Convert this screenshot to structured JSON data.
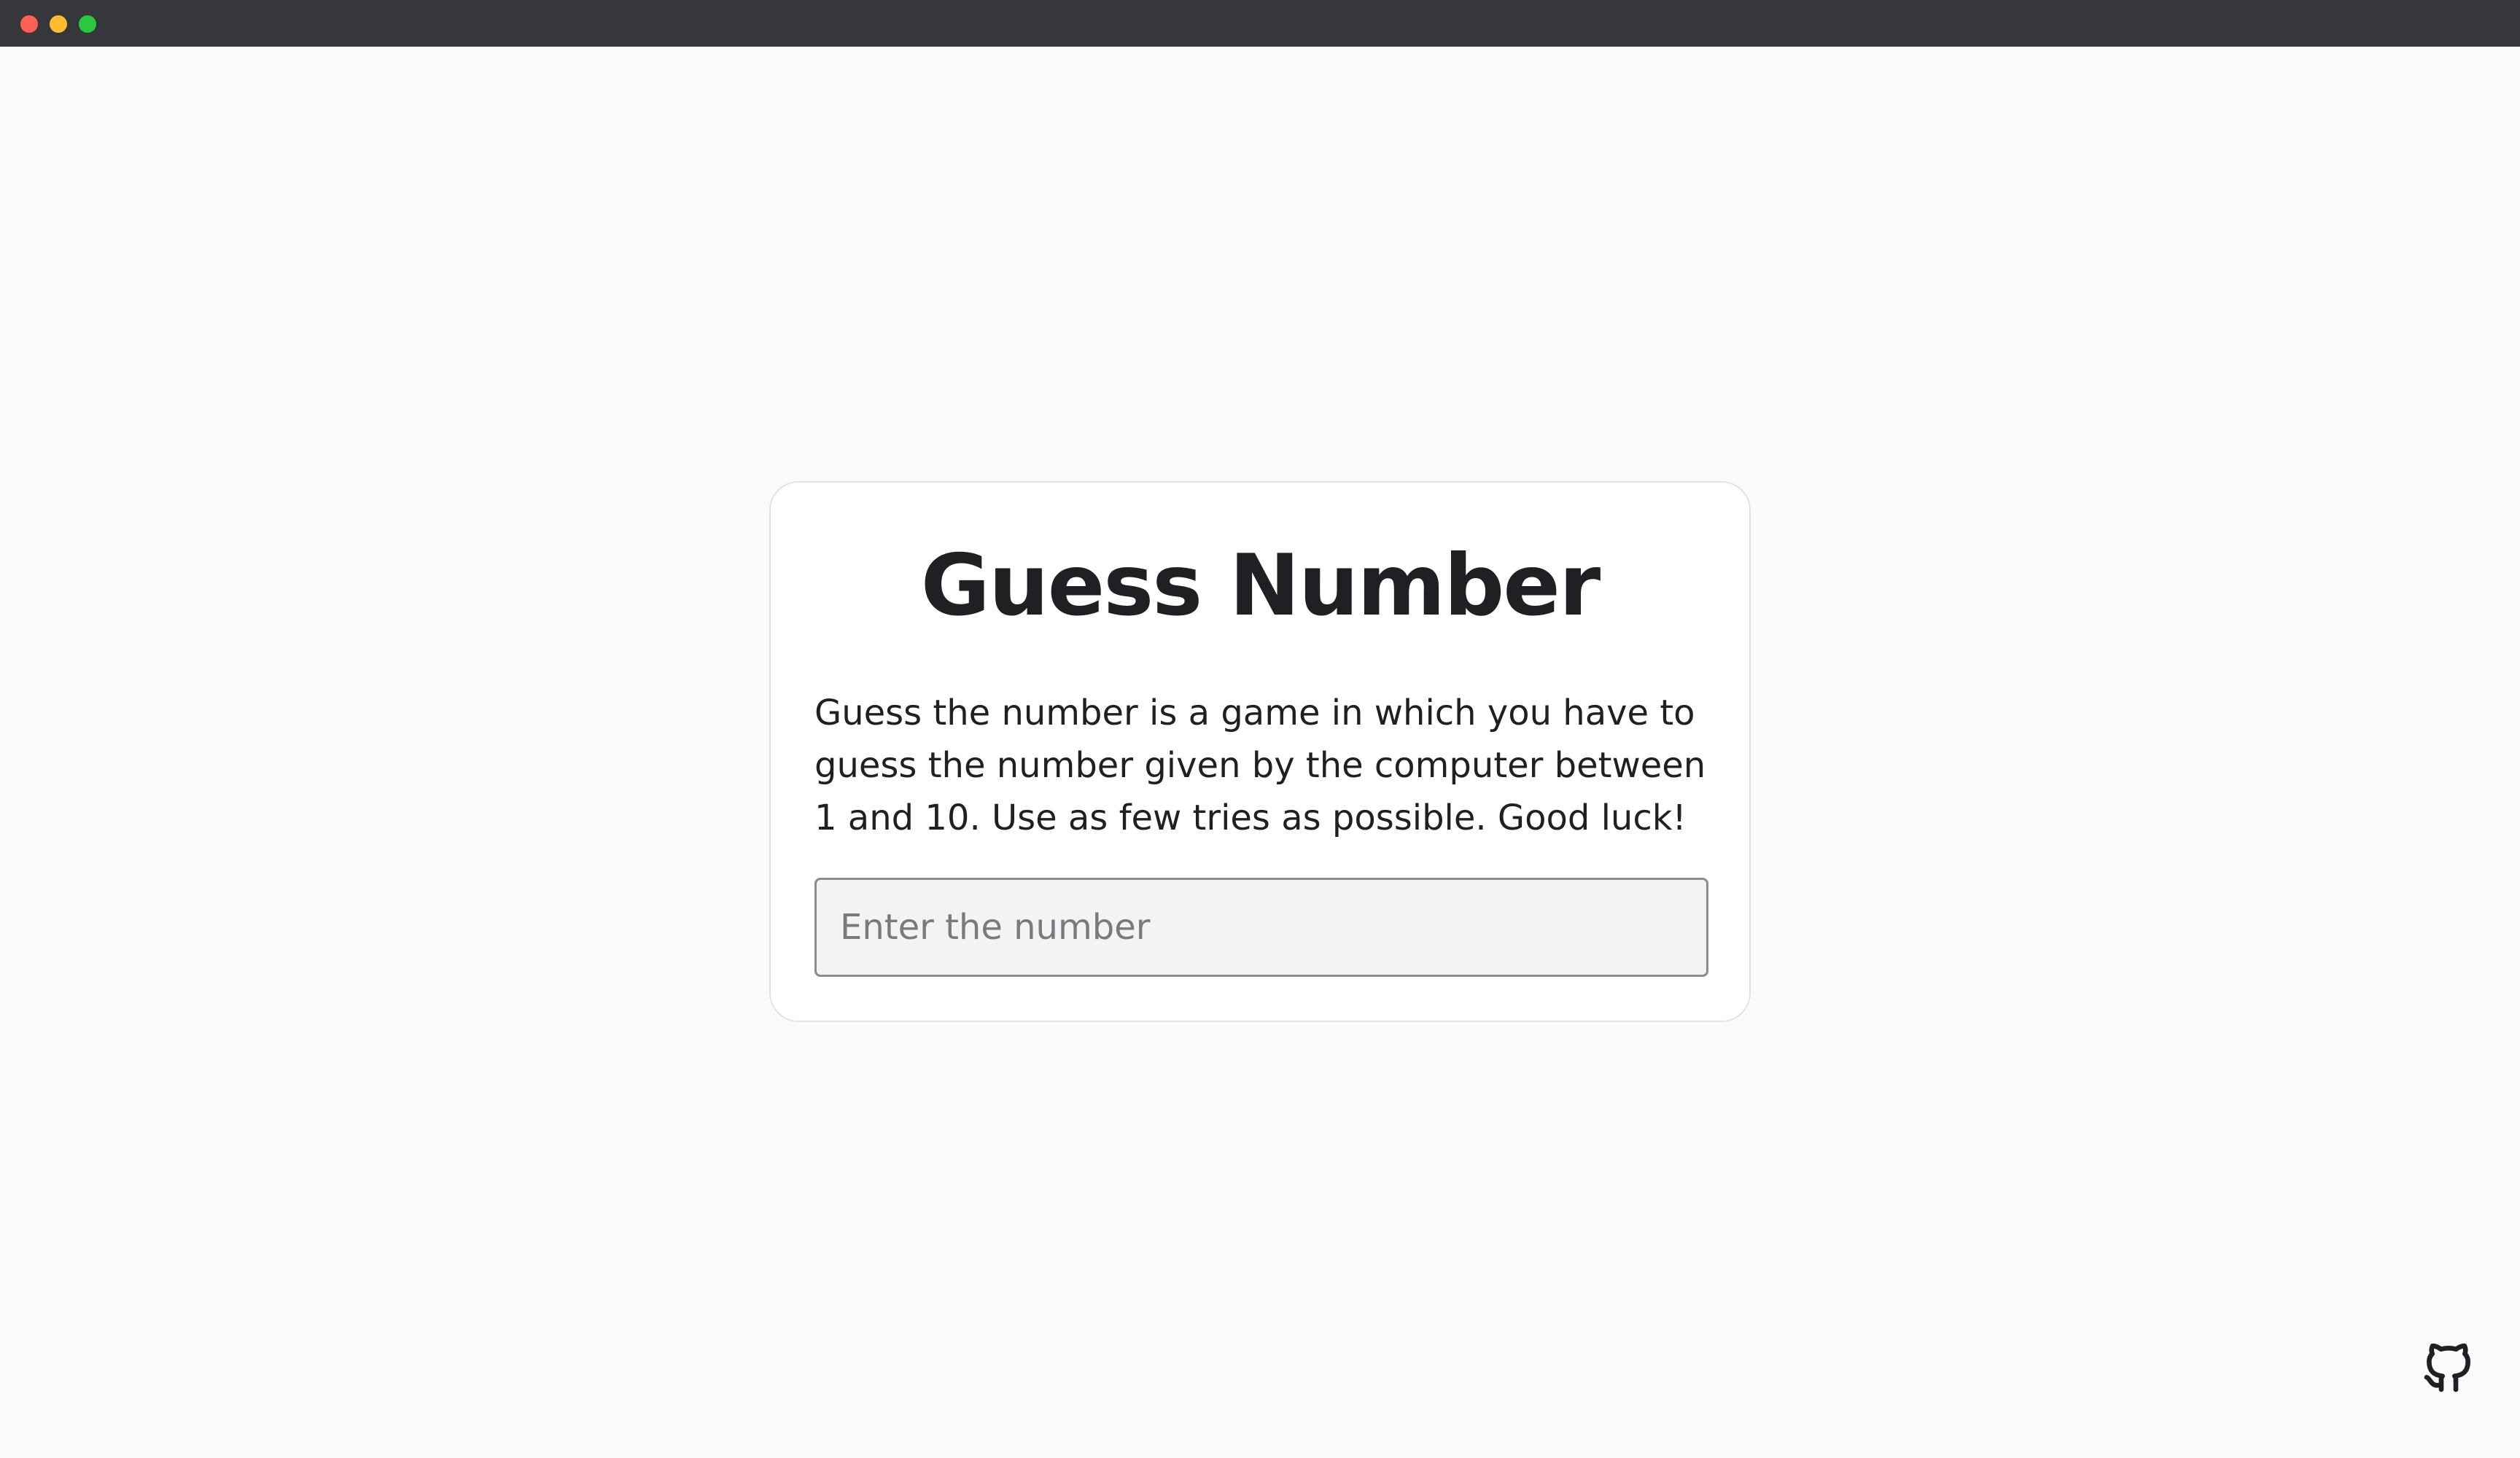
{
  "window": {
    "controls": [
      "close",
      "minimize",
      "maximize"
    ],
    "colors": {
      "titlebar": "#36373a",
      "close": "#fe5f57",
      "minimize": "#febc2e",
      "maximize": "#28c840"
    }
  },
  "card": {
    "title": "Guess Number",
    "description": "Guess the number is a game in which you have to guess the number given by the computer between 1 and 10. Use as few tries as possible. Good luck!",
    "input": {
      "value": "",
      "placeholder": "Enter the number"
    }
  },
  "footer": {
    "icon": "github-icon"
  },
  "colors": {
    "background": "#fafafa",
    "card": "#ffffff",
    "text": "#1f2023",
    "input_background": "#f3f3f5"
  }
}
